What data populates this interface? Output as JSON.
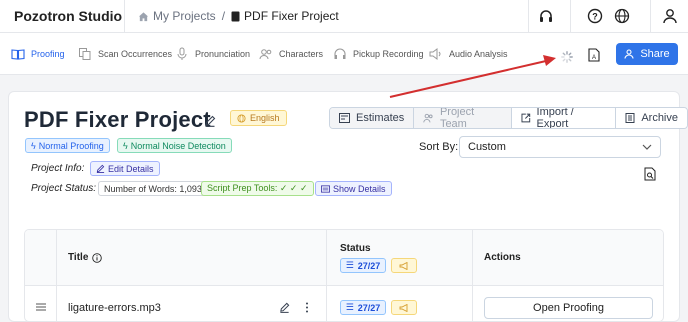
{
  "topbar": {
    "brand": "Pozotron Studio",
    "breadcrumb": {
      "parent": "My Projects",
      "separator": "/",
      "current": "PDF Fixer Project"
    },
    "icons": [
      "headphones-icon",
      "help-icon",
      "globe-icon",
      "user-icon"
    ]
  },
  "toolbar": {
    "items": [
      {
        "label": "Proofing",
        "icon": "book-open-icon",
        "active": true
      },
      {
        "label": "Scan Occurrences",
        "icon": "copy-icon",
        "active": false
      },
      {
        "label": "Pronunciation",
        "icon": "microphone-icon",
        "active": false
      },
      {
        "label": "Characters",
        "icon": "users-icon",
        "active": false
      },
      {
        "label": "Pickup Recording",
        "icon": "headset-icon",
        "active": false
      },
      {
        "label": "Audio Analysis",
        "icon": "speaker-icon",
        "active": false
      }
    ],
    "share_label": "Share"
  },
  "project": {
    "title": "PDF Fixer Project",
    "language": "English",
    "tags": [
      "Normal Proofing",
      "Normal Noise Detection"
    ],
    "info_label": "Project Info:",
    "edit_details": "Edit Details",
    "status_label": "Project Status:",
    "words": "Number of Words: 1,093",
    "script_prep": "Script Prep Tools: ✓ ✓ ✓",
    "show_details": "Show Details"
  },
  "actions": {
    "estimates": "Estimates",
    "project_team": "Project Team",
    "import_export": "Import / Export",
    "archive": "Archive"
  },
  "sort": {
    "label": "Sort By:",
    "value": "Custom"
  },
  "table": {
    "headers": {
      "title": "Title",
      "status": "Status",
      "actions": "Actions"
    },
    "header_status_count": "27/27",
    "rows": [
      {
        "title": "ligature-errors.mp3",
        "status_count": "27/27",
        "action": "Open Proofing"
      }
    ]
  },
  "colors": {
    "accent": "#2f74e8",
    "arrow": "#d32f2f"
  }
}
